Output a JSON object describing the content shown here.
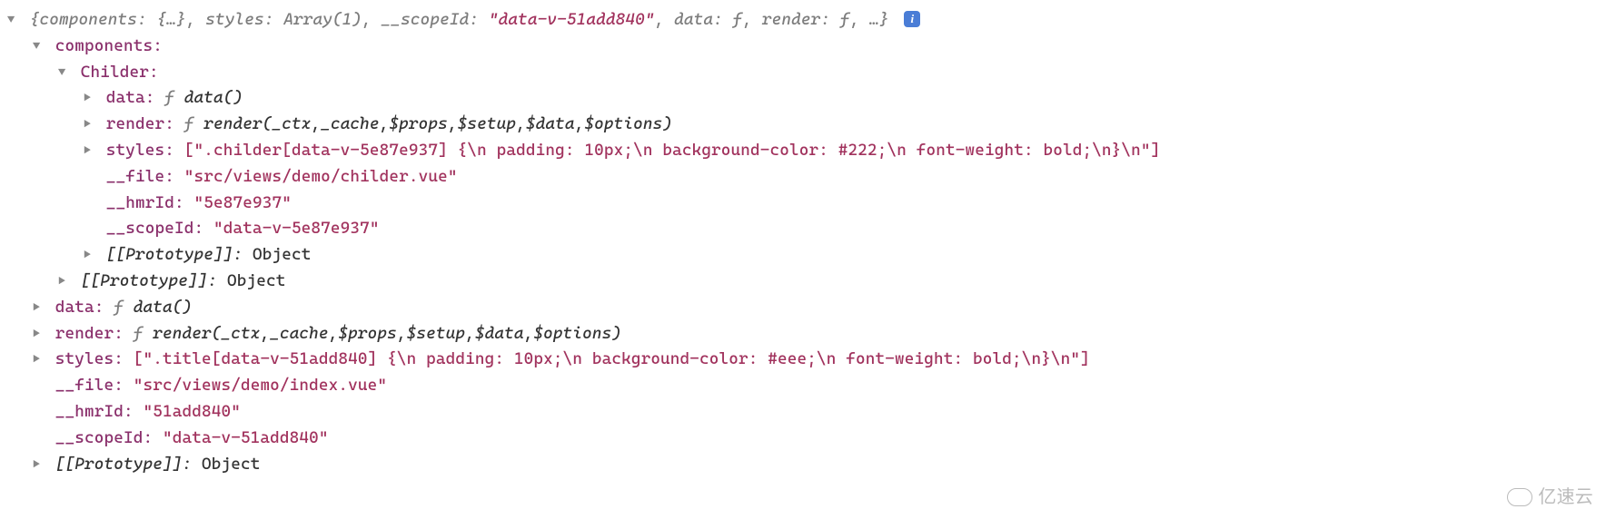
{
  "summary": {
    "prefix": "{",
    "components_key": "components",
    "components_val": "{…}",
    "styles_key": "styles",
    "styles_val": "Array(1)",
    "scope_key": "__scopeId",
    "scope_val": "\"data-v-51add840\"",
    "data_key": "data",
    "data_val": "f",
    "render_key": "render",
    "render_val": "f",
    "suffix": ", …}"
  },
  "lvl1": {
    "components_key": "components:",
    "data_key": "data:",
    "data_val_f": "f ",
    "data_val_sig": "data()",
    "render_key": "render:",
    "render_val_f": "f ",
    "render_val_sig": "render(_ctx,_cache,$props,$setup,$data,$options)",
    "styles_key": "styles:",
    "styles_val": " [\".title[data-v-51add840] {\\n  padding: 10px;\\n  background-color: #eee;\\n  font-weight: bold;\\n}\\n\"]",
    "file_key": "__file:",
    "file_val": " \"src/views/demo/index.vue\"",
    "hmr_key": "__hmrId:",
    "hmr_val": " \"51add840\"",
    "scope_key": "__scopeId:",
    "scope_val": " \"data-v-51add840\"",
    "proto_key": "[[Prototype]]:",
    "proto_val": " Object"
  },
  "lvl2": {
    "childer_key": "Childer:",
    "proto_key": "[[Prototype]]:",
    "proto_val": " Object"
  },
  "lvl3": {
    "data_key": "data:",
    "data_val_f": "f ",
    "data_val_sig": "data()",
    "render_key": "render:",
    "render_val_f": "f ",
    "render_val_sig": "render(_ctx,_cache,$props,$setup,$data,$options)",
    "styles_key": "styles:",
    "styles_val": " [\".childer[data-v-5e87e937] {\\n  padding: 10px;\\n  background-color: #222;\\n  font-weight: bold;\\n}\\n\"]",
    "file_key": "__file:",
    "file_val": " \"src/views/demo/childer.vue\"",
    "hmr_key": "__hmrId:",
    "hmr_val": " \"5e87e937\"",
    "scope_key": "__scopeId:",
    "scope_val": " \"data-v-5e87e937\"",
    "proto_key": "[[Prototype]]:",
    "proto_val": " Object"
  },
  "watermark": "亿速云"
}
